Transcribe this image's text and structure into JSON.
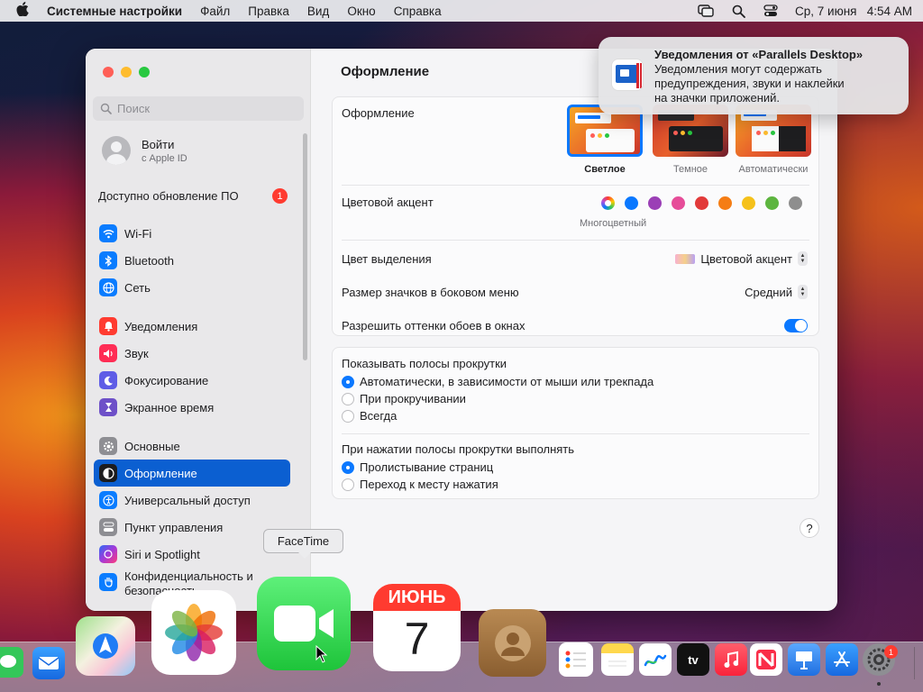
{
  "menubar": {
    "app_name": "Системные настройки",
    "menus": [
      "Файл",
      "Правка",
      "Вид",
      "Окно",
      "Справка"
    ],
    "datetime": "Ср, 7 июня   4:54 AM"
  },
  "sidebar": {
    "search_placeholder": "Поиск",
    "account_title": "Войти",
    "account_sub": "с Apple ID",
    "update_label": "Доступно обновление ПО",
    "update_badge": "1",
    "group1": [
      {
        "label": "Wi-Fi",
        "color": "#0a7cff"
      },
      {
        "label": "Bluetooth",
        "color": "#0a7cff"
      },
      {
        "label": "Сеть",
        "color": "#0a7cff"
      }
    ],
    "group2": [
      {
        "label": "Уведомления",
        "color": "#ff3b30"
      },
      {
        "label": "Звук",
        "color": "#ff2d55"
      },
      {
        "label": "Фокусирование",
        "color": "#5e5ce6"
      },
      {
        "label": "Экранное время",
        "color": "#6e50c8"
      }
    ],
    "group3": [
      {
        "label": "Основные",
        "color": "#8e8e93"
      },
      {
        "label": "Оформление",
        "color": "#1c1c1e",
        "active": true
      },
      {
        "label": "Универсальный доступ",
        "color": "#0a7cff"
      },
      {
        "label": "Пункт управления",
        "color": "#8e8e93"
      },
      {
        "label": "Siri и Spotlight",
        "color": "#a33ad8"
      },
      {
        "label": "Конфиденциальность и безопасность",
        "color": "#0a7cff"
      }
    ]
  },
  "main": {
    "title": "Оформление",
    "appearance_label": "Оформление",
    "themes": [
      {
        "label": "Светлое",
        "selected": true
      },
      {
        "label": "Темное",
        "selected": false
      },
      {
        "label": "Автоматически",
        "selected": false
      }
    ],
    "accent_label": "Цветовой акцент",
    "accent_selected_name": "Многоцветный",
    "accent_colors": [
      "#0a78ff",
      "#9b3fb6",
      "#e64d99",
      "#e23a3a",
      "#f57d14",
      "#f5c11a",
      "#5db53f",
      "#8e8e8e"
    ],
    "highlight_label": "Цвет выделения",
    "highlight_value": "Цветовой акцент",
    "icon_size_label": "Размер значков в боковом меню",
    "icon_size_value": "Средний",
    "tint_label": "Разрешить оттенки обоев в окнах",
    "tint_on": true,
    "scrollbars_label": "Показывать полосы прокрутки",
    "scrollbars_options": [
      {
        "label": "Автоматически, в зависимости от мыши или трекпада",
        "selected": true
      },
      {
        "label": "При прокручивании",
        "selected": false
      },
      {
        "label": "Всегда",
        "selected": false
      }
    ],
    "click_label": "При нажатии полосы прокрутки выполнять",
    "click_options": [
      {
        "label": "Пролистывание страниц",
        "selected": true
      },
      {
        "label": "Переход к месту нажатия",
        "selected": false
      }
    ],
    "help": "?"
  },
  "notification": {
    "title": "Уведомления от «Parallels Desktop»",
    "body_lines": [
      "Уведомления могут содержать",
      "предупреждения, звуки и наклейки",
      "на значки приложений."
    ]
  },
  "tooltip": "FaceTime",
  "dock": {
    "calendar_month": "ИЮНЬ",
    "calendar_day": "7",
    "appletv": "tv",
    "settings_badge": "1"
  }
}
